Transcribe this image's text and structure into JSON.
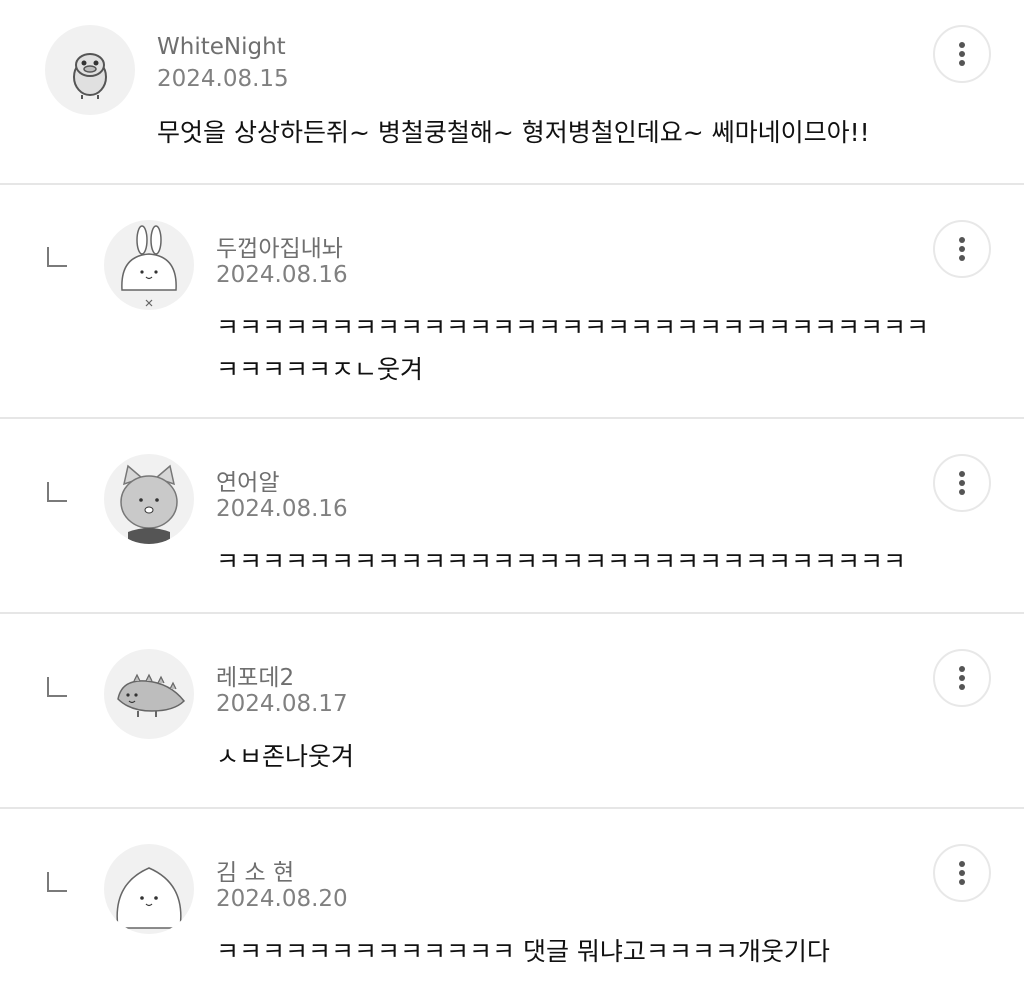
{
  "comments": [
    {
      "nickname": "WhiteNight",
      "date": "2024.08.15",
      "text": "무엇을 상상하든쥐~ 병철쿵철해~ 형저병철인데요~ 쎄마네이므아!!",
      "is_reply": false,
      "avatar_icon": "duck-character-icon"
    },
    {
      "nickname": "두껍아집내놔",
      "date": "2024.08.16",
      "text": "ㅋㅋㅋㅋㅋㅋㅋㅋㅋㅋㅋㅋㅋㅋㅋㅋㅋㅋㅋㅋㅋㅋㅋㅋㅋㅋㅋㅋㅋㅋㅋ\nㅋㅋㅋㅋㅋㅈㄴ웃겨",
      "is_reply": true,
      "avatar_icon": "rabbit-character-icon"
    },
    {
      "nickname": "연어알",
      "date": "2024.08.16",
      "text": "ㅋㅋㅋㅋㅋㅋㅋㅋㅋㅋㅋㅋㅋㅋㅋㅋㅋㅋㅋㅋㅋㅋㅋㅋㅋㅋㅋㅋㅋㅋ",
      "is_reply": true,
      "avatar_icon": "cat-character-icon"
    },
    {
      "nickname": "레포데2",
      "date": "2024.08.17",
      "text": "ㅅㅂ존나웃겨",
      "is_reply": true,
      "avatar_icon": "dinosaur-character-icon"
    },
    {
      "nickname": "김 소 현",
      "date": "2024.08.20",
      "text": "ㅋㅋㅋㅋㅋㅋㅋㅋㅋㅋㅋㅋㅋ 댓글 뭐냐고ㅋㅋㅋㅋ개웃기다",
      "is_reply": true,
      "avatar_icon": "round-face-character-icon"
    }
  ],
  "menu_icon": "more-vertical-icon",
  "colors": {
    "nickname": "#6f6f6f",
    "date": "#808080",
    "text": "#111111",
    "divider": "#e6e6e6",
    "avatar_bg": "#f1f1f1"
  }
}
